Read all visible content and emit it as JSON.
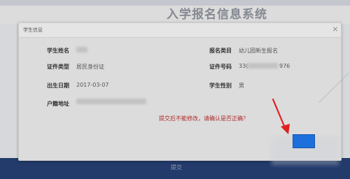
{
  "page": {
    "title": "入学报名信息系统",
    "footer_button": "提交"
  },
  "modal": {
    "title": "学生信息",
    "close_symbol": "×",
    "fields": {
      "student_name_label": "学生姓名",
      "id_type_label": "证件类型",
      "id_type_value": "居民身份证",
      "birth_date_label": "出生日期",
      "birth_date_value": "2017-03-07",
      "household_address_label": "户籍地址",
      "category_label": "报名类目",
      "category_value": "幼儿园新生报名",
      "id_number_label": "证件号码",
      "id_number_prefix": "33(",
      "id_number_suffix": "976",
      "gender_label": "学生性别",
      "gender_value": "男"
    },
    "warning": "提交后不能修改，请确认是否正确？"
  },
  "colors": {
    "warning_text": "#b02a2a",
    "confirm_button": "#1d6fdc",
    "footer_bar": "#12306a",
    "arrow": "#e02020"
  },
  "icons": {
    "close": "close-icon",
    "annotation": "red-arrow-icon"
  }
}
